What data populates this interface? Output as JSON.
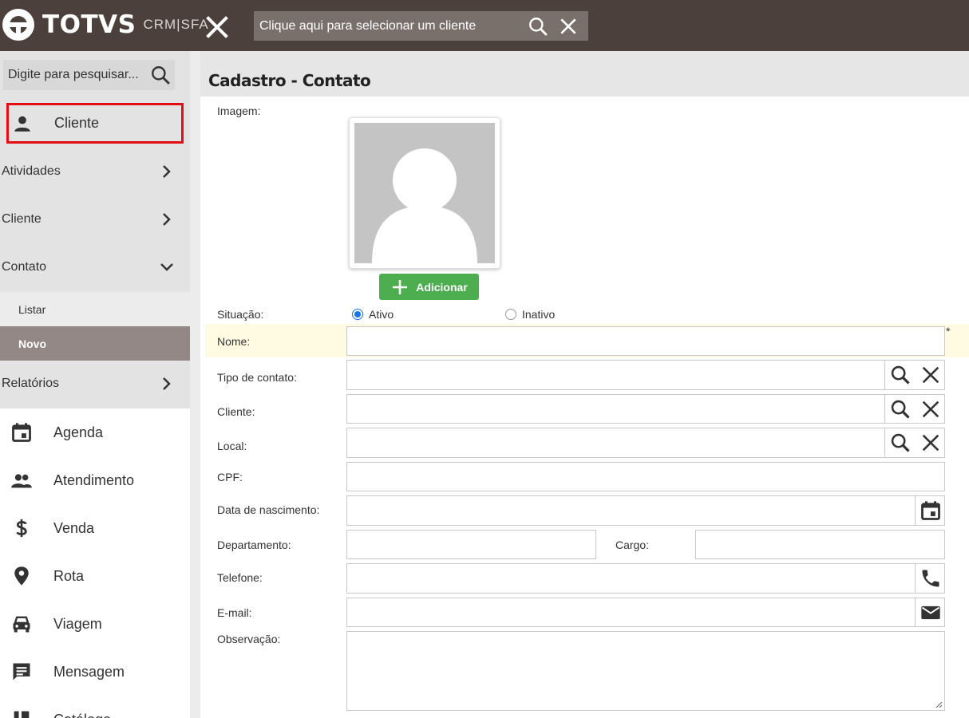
{
  "topbar": {
    "logo_text": "TOTVS",
    "logo_sub": "CRM|SFA",
    "client_select_placeholder": "Clique aqui para selecionar um cliente"
  },
  "sidebar": {
    "search_placeholder": "Digite para pesquisar...",
    "highlight_item": "Cliente",
    "nav": [
      {
        "label": "Atividades",
        "state": "collapsed"
      },
      {
        "label": "Cliente",
        "state": "collapsed"
      },
      {
        "label": "Contato",
        "state": "expanded"
      },
      {
        "label": "Relatórios",
        "state": "collapsed"
      }
    ],
    "contato_sub": [
      {
        "label": "Listar"
      },
      {
        "label": "Novo",
        "active": true
      }
    ],
    "main_menu": [
      {
        "label": "Agenda",
        "icon": "calendar-icon"
      },
      {
        "label": "Atendimento",
        "icon": "people-icon"
      },
      {
        "label": "Venda",
        "icon": "dollar-icon"
      },
      {
        "label": "Rota",
        "icon": "pin-icon"
      },
      {
        "label": "Viagem",
        "icon": "car-icon"
      },
      {
        "label": "Mensagem",
        "icon": "message-icon"
      },
      {
        "label": "Catálogo",
        "icon": "book-icon"
      }
    ]
  },
  "form": {
    "title": "Cadastro - Contato",
    "labels": {
      "imagem": "Imagem:",
      "situacao": "Situação:",
      "nome": "Nome:",
      "tipo": "Tipo de contato:",
      "cliente": "Cliente:",
      "local": "Local:",
      "cpf": "CPF:",
      "nascimento": "Data de nascimento:",
      "departamento": "Departamento:",
      "cargo": "Cargo:",
      "telefone": "Telefone:",
      "email": "E-mail:",
      "observacao": "Observação:"
    },
    "add_button": "Adicionar",
    "situacao_options": [
      "Ativo",
      "Inativo"
    ],
    "situacao_selected": "Ativo",
    "required_mark": "*"
  },
  "colors": {
    "topbar": "#4b403c",
    "accent_green": "#4cae4f",
    "highlight_red": "#e20e14",
    "radio_blue": "#1a73e8",
    "required_band": "#fffbe3"
  }
}
